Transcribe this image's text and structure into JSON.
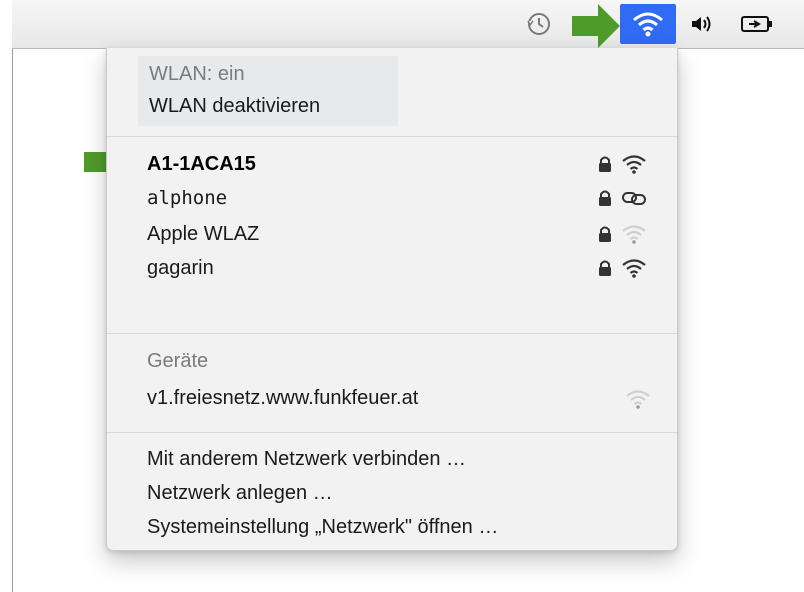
{
  "menu": {
    "status": "WLAN: ein",
    "toggle": "WLAN deaktivieren",
    "networks": [
      {
        "name": "A1-1ACA15",
        "locked": true,
        "signal": "full"
      },
      {
        "name": "alphone",
        "locked": true,
        "signal": "link"
      },
      {
        "name": "Apple WLAZ",
        "locked": true,
        "signal": "weak"
      },
      {
        "name": "gagarin",
        "locked": true,
        "signal": "full"
      }
    ],
    "devices_header": "Geräte",
    "device": "v1.freiesnetz.www.funkfeuer.at",
    "actions": [
      "Mit anderem Netzwerk verbinden …",
      "Netzwerk anlegen …",
      "Systemeinstellung „Netzwerk\" öffnen …"
    ]
  },
  "menubar": {
    "icons": [
      "time-machine-icon",
      "wifi-icon",
      "volume-icon",
      "battery-icon"
    ]
  },
  "colors": {
    "accent": "#2f6bf4",
    "arrow": "#4f9b2a"
  }
}
